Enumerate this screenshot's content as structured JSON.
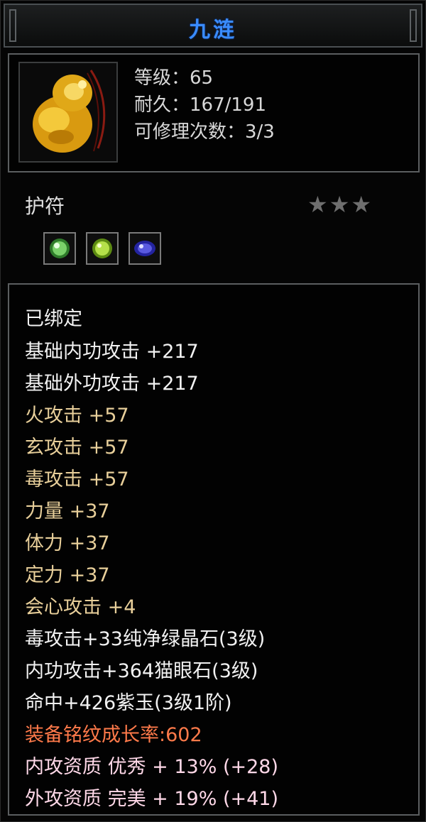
{
  "title": "九涟",
  "item": {
    "level": "等级：65",
    "durability": "耐久：167/191",
    "repairs": "可修理次数：3/3",
    "type": "护符",
    "stars": "★★★"
  },
  "gems": [
    {
      "name": "green-crystal-gem-icon",
      "color": "#7ad06a"
    },
    {
      "name": "yellowgreen-gem-icon",
      "color": "#b5e04a"
    },
    {
      "name": "purple-jade-gem-icon",
      "color": "#5a5ae0"
    }
  ],
  "attributes": [
    {
      "text": "已绑定"
    },
    {
      "text": "基础内功攻击  +217"
    },
    {
      "text": "基础外功攻击  +217"
    },
    {
      "text": "火攻击  +57"
    },
    {
      "text": "玄攻击  +57"
    },
    {
      "text": "毒攻击  +57"
    },
    {
      "text": "力量  +37"
    },
    {
      "text": "体力  +37"
    },
    {
      "text": "定力  +37"
    },
    {
      "text": "会心攻击  +4"
    },
    {
      "text": "毒攻击+33纯净绿晶石(3级)"
    },
    {
      "text": "内功攻击+364猫眼石(3级)"
    },
    {
      "text": "命中+426紫玉(3级1阶)"
    },
    {
      "text": "装备铭纹成长率:602"
    },
    {
      "text": "内攻资质  优秀  +  13%  (+28)"
    },
    {
      "text": "外攻资质  完美  +  19%  (+41)"
    }
  ]
}
